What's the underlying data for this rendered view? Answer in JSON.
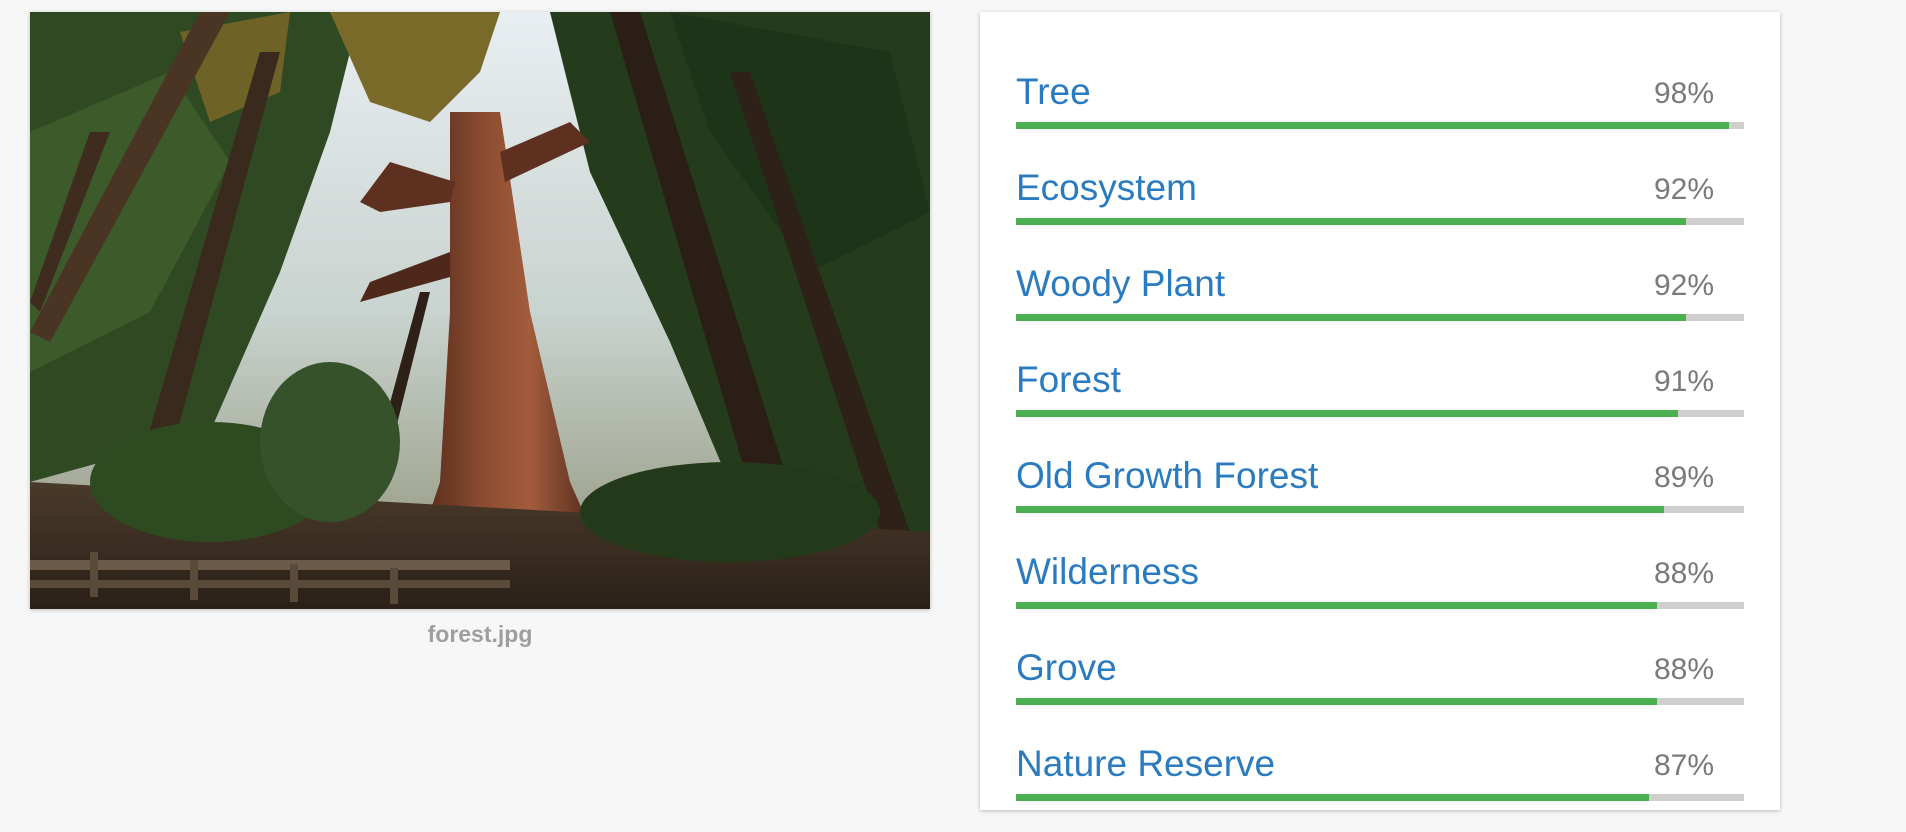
{
  "image": {
    "filename": "forest.jpg"
  },
  "labels": [
    {
      "name": "Tree",
      "score_text": "98%",
      "score": 0.98
    },
    {
      "name": "Ecosystem",
      "score_text": "92%",
      "score": 0.92
    },
    {
      "name": "Woody Plant",
      "score_text": "92%",
      "score": 0.92
    },
    {
      "name": "Forest",
      "score_text": "91%",
      "score": 0.91
    },
    {
      "name": "Old Growth Forest",
      "score_text": "89%",
      "score": 0.89
    },
    {
      "name": "Wilderness",
      "score_text": "88%",
      "score": 0.88
    },
    {
      "name": "Grove",
      "score_text": "88%",
      "score": 0.88
    },
    {
      "name": "Nature Reserve",
      "score_text": "87%",
      "score": 0.87
    }
  ],
  "colors": {
    "label_text": "#2a7bbf",
    "bar_fill": "#4caf50",
    "bar_track": "#cfcfcf",
    "score_text": "#7a7a7a",
    "caption_text": "#9e9e9e"
  }
}
